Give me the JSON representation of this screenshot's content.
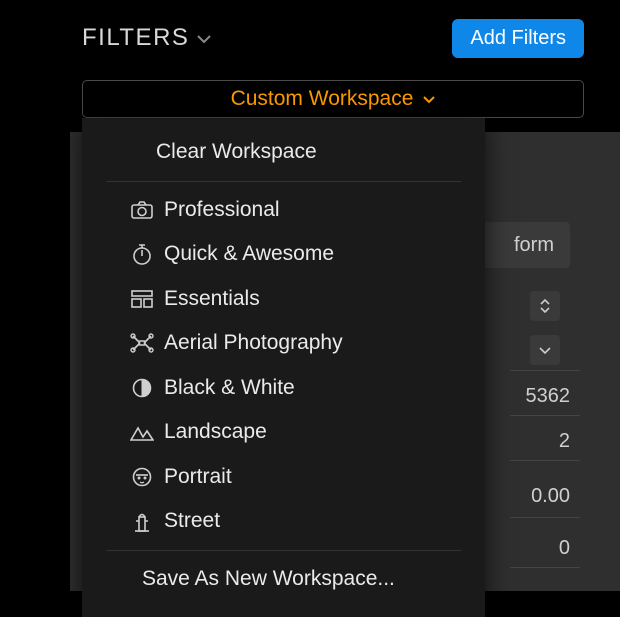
{
  "header": {
    "title": "FILTERS",
    "add_button": "Add Filters"
  },
  "workspace_button": {
    "label": "Custom Workspace"
  },
  "menu": {
    "clear": "Clear Workspace",
    "presets": [
      {
        "icon": "camera-icon",
        "label": "Professional"
      },
      {
        "icon": "stopwatch-icon",
        "label": "Quick & Awesome"
      },
      {
        "icon": "layout-icon",
        "label": "Essentials"
      },
      {
        "icon": "drone-icon",
        "label": "Aerial Photography"
      },
      {
        "icon": "contrast-icon",
        "label": "Black & White"
      },
      {
        "icon": "mountain-icon",
        "label": "Landscape"
      },
      {
        "icon": "face-icon",
        "label": "Portrait"
      },
      {
        "icon": "hydrant-icon",
        "label": "Street"
      }
    ],
    "save": "Save As New Workspace..."
  },
  "background_panel": {
    "section_label_fragment": "form",
    "row1_fragment": "5362",
    "row2_fragment": "2",
    "row3_value": "0.00",
    "row4_value": "0"
  }
}
